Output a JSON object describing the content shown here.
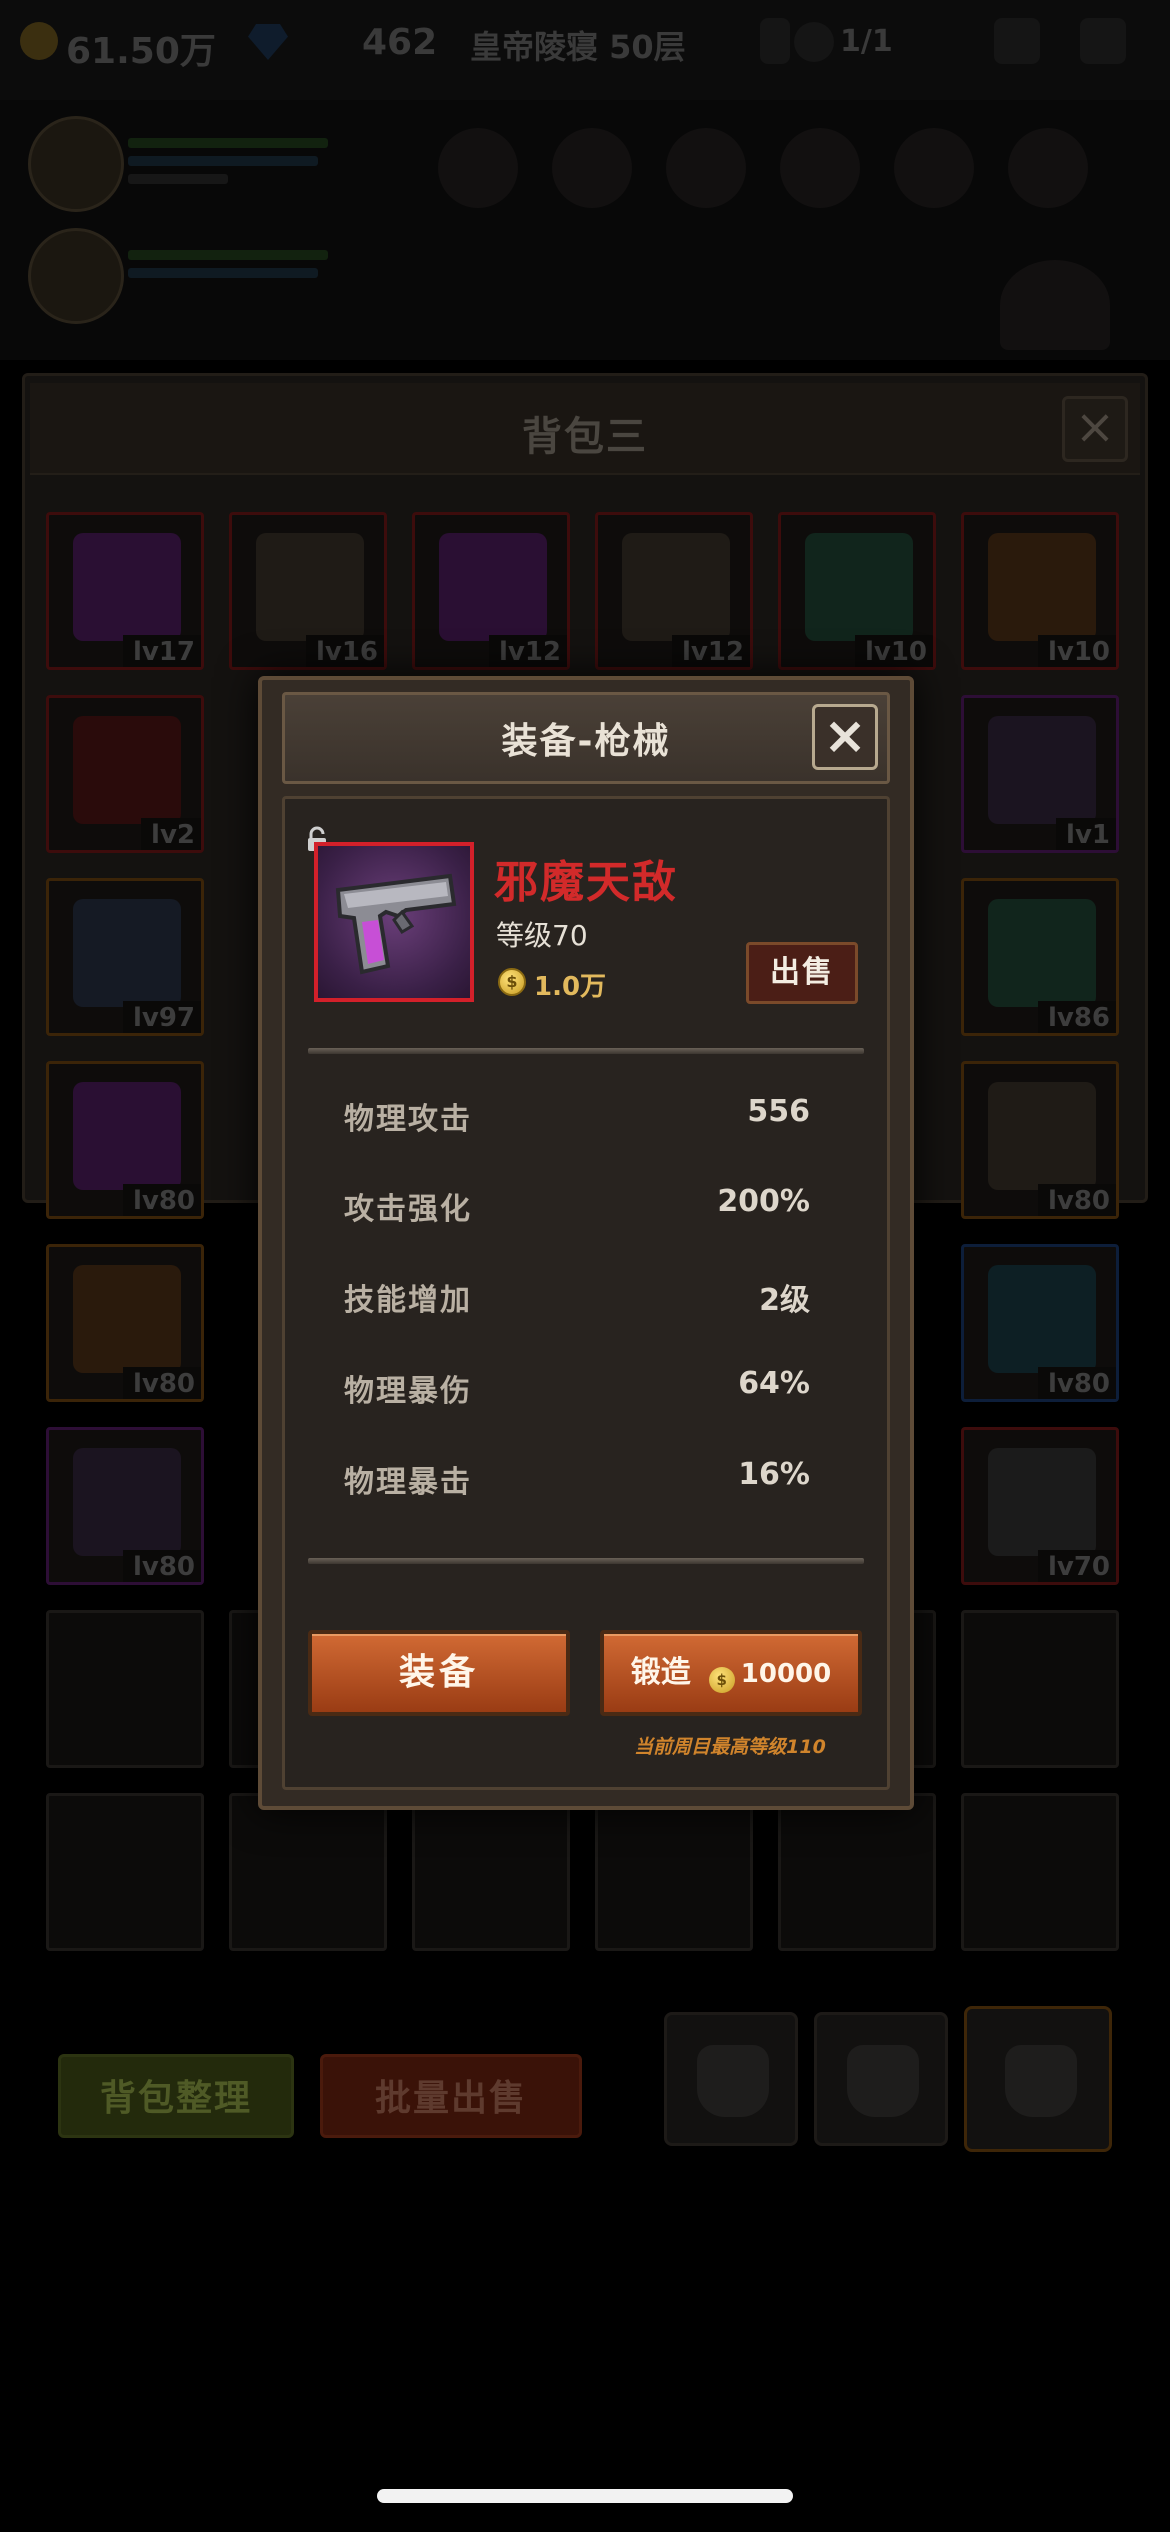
{
  "hud": {
    "gold": "61.50万",
    "gems": "462",
    "location": "皇帝陵寝 50层",
    "keys": "1/1"
  },
  "backpack": {
    "title": "背包三",
    "close_label": "×",
    "slots": [
      {
        "level": "lv17",
        "rarity": "r",
        "icon": "amulet-icon"
      },
      {
        "level": "lv16",
        "rarity": "r",
        "icon": "helmet-icon"
      },
      {
        "level": "lv12",
        "rarity": "r",
        "icon": "amulet-icon"
      },
      {
        "level": "lv12",
        "rarity": "r",
        "icon": "helmet-icon"
      },
      {
        "level": "lv10",
        "rarity": "r",
        "icon": "ring-icon"
      },
      {
        "level": "lv10",
        "rarity": "r",
        "icon": "shield-icon"
      },
      {
        "level": "lv2",
        "rarity": "r",
        "icon": "gauntlet-icon"
      },
      {
        "level": "lv1",
        "rarity": "p",
        "icon": "armor-icon"
      },
      {
        "level": "lv97",
        "rarity": "o",
        "icon": "sword-icon"
      },
      {
        "level": "lv86",
        "rarity": "o",
        "icon": "ring-icon"
      },
      {
        "level": "lv80",
        "rarity": "o",
        "icon": "amulet-icon"
      },
      {
        "level": "lv80",
        "rarity": "o",
        "icon": "helmet-icon"
      },
      {
        "level": "lv80",
        "rarity": "o",
        "icon": "shield-icon"
      },
      {
        "level": "lv80",
        "rarity": "b",
        "icon": "orb-icon"
      },
      {
        "level": "lv80",
        "rarity": "p",
        "icon": "armor-icon"
      },
      {
        "level": "lv70",
        "rarity": "r",
        "icon": "gun-icon"
      }
    ],
    "sort_label": "背包整理",
    "bulk_sell_label": "批量出售"
  },
  "modal": {
    "title": "装备-枪械",
    "close_label": "×",
    "item": {
      "name": "邪魔天敌",
      "level_text": "等级70",
      "price": "1.0万",
      "sell_label": "出售",
      "icon": "pistol-icon"
    },
    "stats": [
      {
        "name": "物理攻击",
        "value": "556"
      },
      {
        "name": "攻击强化",
        "value": "200%"
      },
      {
        "name": "技能增加",
        "value": "2级"
      },
      {
        "name": "物理暴伤",
        "value": "64%"
      },
      {
        "name": "物理暴击",
        "value": "16%"
      }
    ],
    "equip_label": "装备",
    "forge_label": "锻造",
    "forge_cost": "10000",
    "forge_note": "当前周目最高等级110",
    "coin_glyph": "$"
  },
  "colors": {
    "accent_orange": "#c4582a",
    "item_name_red": "#d22a2a",
    "gold": "#e2b95d"
  }
}
